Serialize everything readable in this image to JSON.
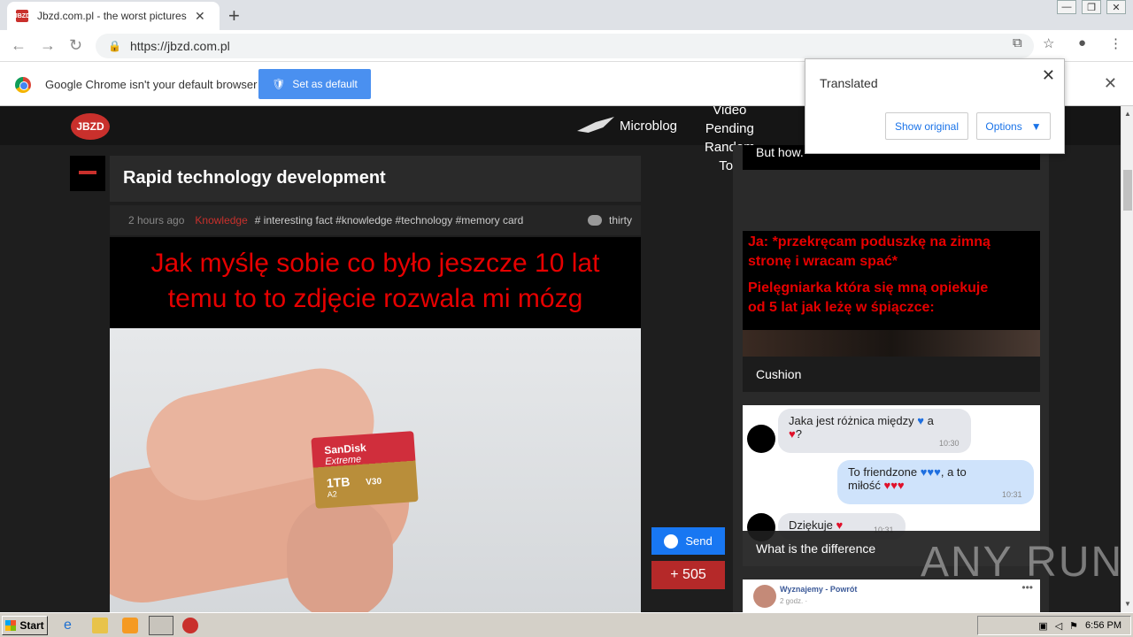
{
  "browser": {
    "tab_title": "Jbzd.com.pl - the worst pictures on I",
    "tab_favicon": "JBZD",
    "url": "https://jbzd.com.pl",
    "infobar": {
      "message": "Google Chrome isn't your default browser",
      "button_label": "Set as default"
    }
  },
  "translate_popup": {
    "title": "Translated",
    "show_original": "Show original",
    "options": "Options"
  },
  "site": {
    "logo": "JBZD",
    "nav": {
      "microblog": "Microblog",
      "items": [
        "Video",
        "Pending",
        "Random",
        "Top"
      ]
    }
  },
  "post": {
    "title": "Rapid technology development",
    "time": "2 hours ago",
    "category": "Knowledge",
    "tags": "# interesting fact #knowledge #technology #memory card",
    "comments": "thirty",
    "caption_line1": "Jak myślę sobie co było jeszcze 10 lat",
    "caption_line2": "temu to to zdjęcie rozwala mi mózg",
    "card": {
      "brand": "SanDisk",
      "line": "Extreme",
      "capacity": "1TB",
      "specs": "A2",
      "v": "V30"
    },
    "send_label": "Send",
    "votes": "+ 505"
  },
  "sidebar": {
    "top_label": "But how.",
    "card1": {
      "line1": "Ja: *przekręcam poduszkę na zimną",
      "line2": "stronę i wracam spać*",
      "line3": "Pielęgniarka która się mną opiekuje",
      "line4": "od 5 lat jak leżę w śpiączce:",
      "label": "Cushion"
    },
    "card2": {
      "msg1": "Jaka jest różnica między",
      "msg1b": "a",
      "time1": "10:30",
      "msg2": "To friendzone",
      "msg2b": ", a to",
      "msg2c": "miłość",
      "time2": "10:31",
      "msg3": "Dziękuje",
      "time3": "10:31",
      "label": "What is the difference"
    },
    "card3": {
      "name": "Wyznajemy - Powrót",
      "time": "2 godz. ·"
    }
  },
  "watermark": "ANY RUN",
  "taskbar": {
    "start_label": "Start",
    "clock": "6:56 PM"
  },
  "colors": {
    "accent_red": "#c9302c",
    "messenger_blue": "#1877f2",
    "chrome_blue": "#4a90f0"
  }
}
